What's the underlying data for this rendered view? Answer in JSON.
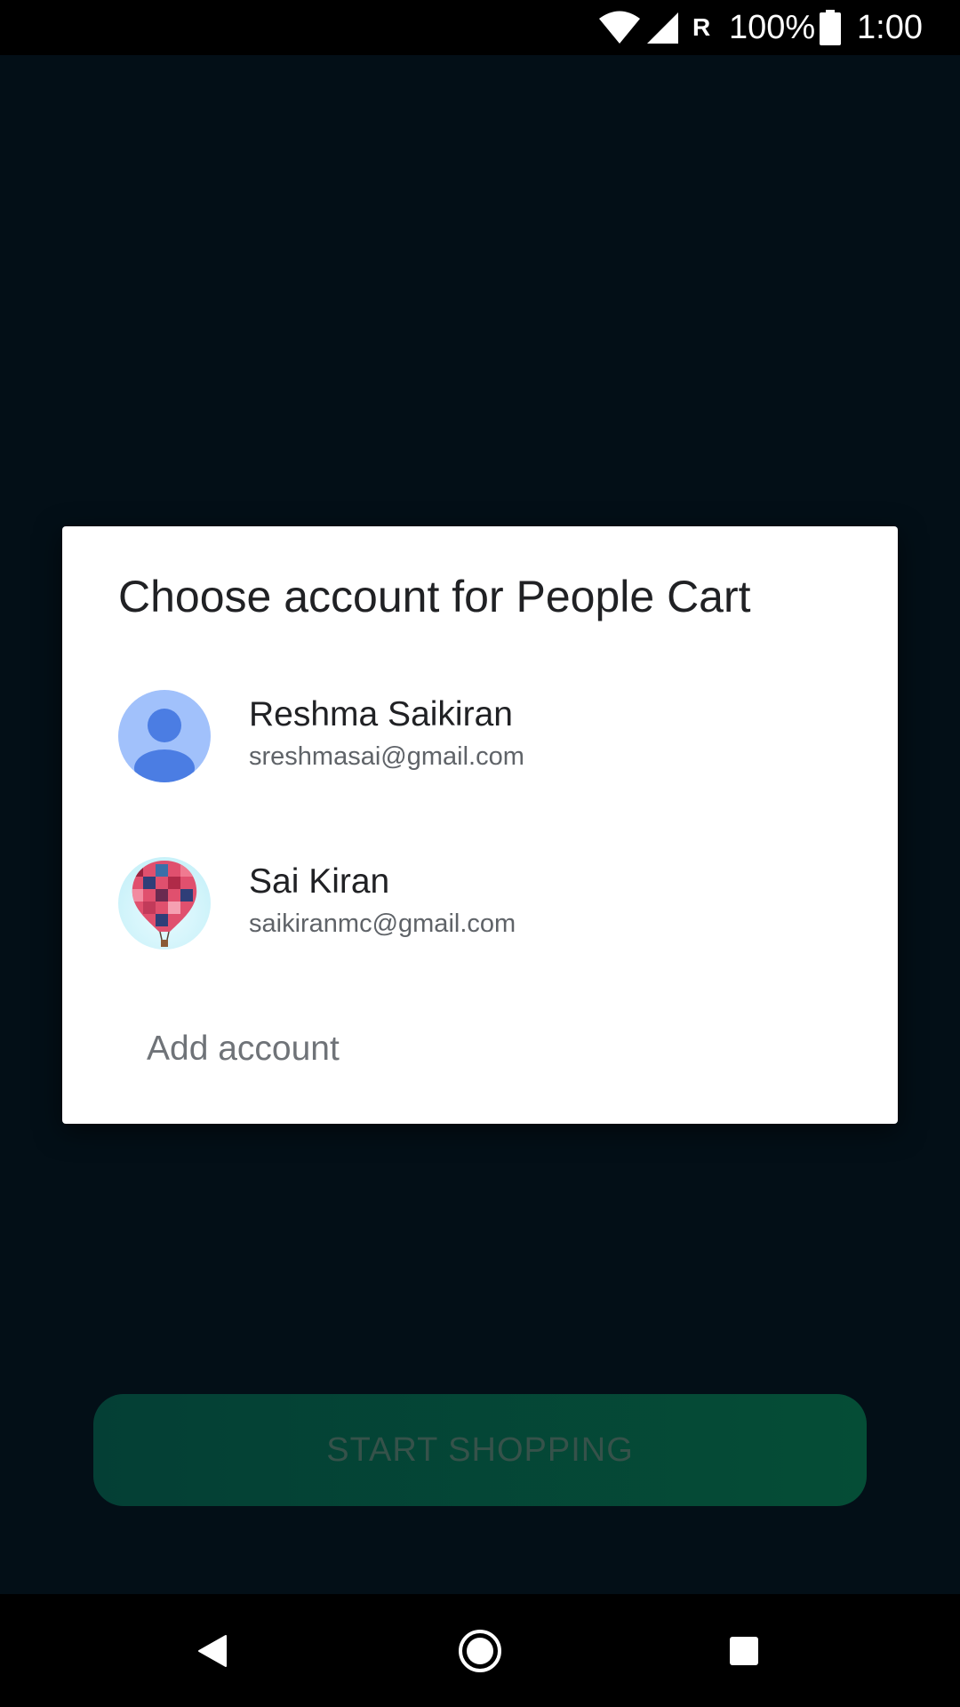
{
  "status_bar": {
    "roaming": "R",
    "battery_percent": "100%",
    "time": "1:00"
  },
  "dialog": {
    "title": "Choose account for People Cart",
    "accounts": [
      {
        "name": "Reshma Saikiran",
        "email": "sreshmasai@gmail.com",
        "avatar": "default-person-avatar"
      },
      {
        "name": "Sai Kiran",
        "email": "saikiranmc@gmail.com",
        "avatar": "hot-air-balloon-photo"
      }
    ],
    "add_account_label": "Add account"
  },
  "background": {
    "start_button_label": "START SHOPPING"
  },
  "nav_bar": {
    "buttons": [
      "back-icon",
      "home-icon",
      "recents-icon"
    ]
  },
  "colors": {
    "dialog_background": "#ffffff",
    "start_button": "#054d36",
    "avatar_light_blue": "#a1c1fb",
    "avatar_blue": "#4b7de3"
  }
}
